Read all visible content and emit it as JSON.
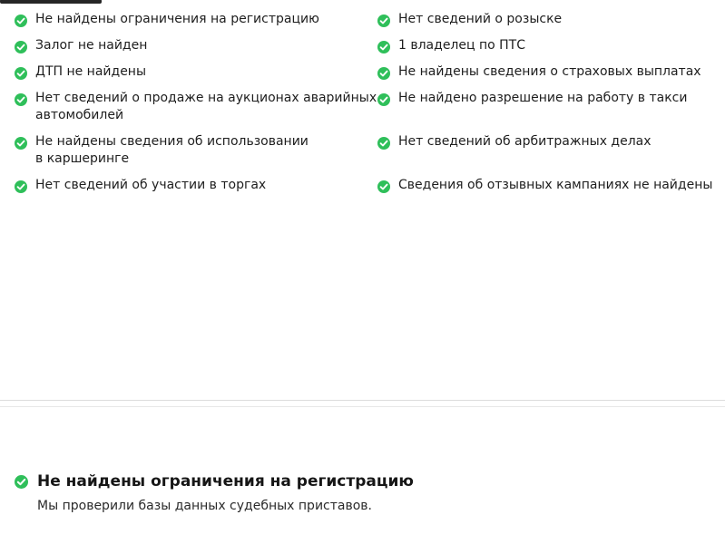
{
  "colors": {
    "check_green": "#2fbf5a",
    "text": "#1e1e1e",
    "divider": "#dcdcdc"
  },
  "summary": {
    "left": [
      {
        "label": "Не найдены ограничения на регистрацию",
        "icon": "check-circle-icon"
      },
      {
        "label": "Залог не найден",
        "icon": "check-circle-icon"
      },
      {
        "label": "ДТП не найдены",
        "icon": "check-circle-icon"
      },
      {
        "label": "Нет сведений о продаже на аукционах аварийных автомобилей",
        "icon": "check-circle-icon"
      },
      {
        "label": "Не найдены сведения об использовании в каршеринге",
        "icon": "check-circle-icon"
      },
      {
        "label": "Нет сведений об участии в торгах",
        "icon": "check-circle-icon"
      }
    ],
    "right": [
      {
        "label": "Нет сведений о розыске",
        "icon": "check-circle-icon"
      },
      {
        "label": "1 владелец по ПТС",
        "icon": "check-circle-icon"
      },
      {
        "label": "Не найдены сведения о страховых выплатах",
        "icon": "check-circle-icon"
      },
      {
        "label": "Не найдено разрешение на работу в такси",
        "icon": "check-circle-icon"
      },
      {
        "label": "Нет сведений об арбитражных делах",
        "icon": "check-circle-icon"
      },
      {
        "label": "Сведения об отзывных кампаниях не найдены",
        "icon": "check-circle-icon"
      }
    ]
  },
  "detail": {
    "title": "Не найдены ограничения на регистрацию",
    "description": "Мы проверили базы данных судебных приставов."
  }
}
